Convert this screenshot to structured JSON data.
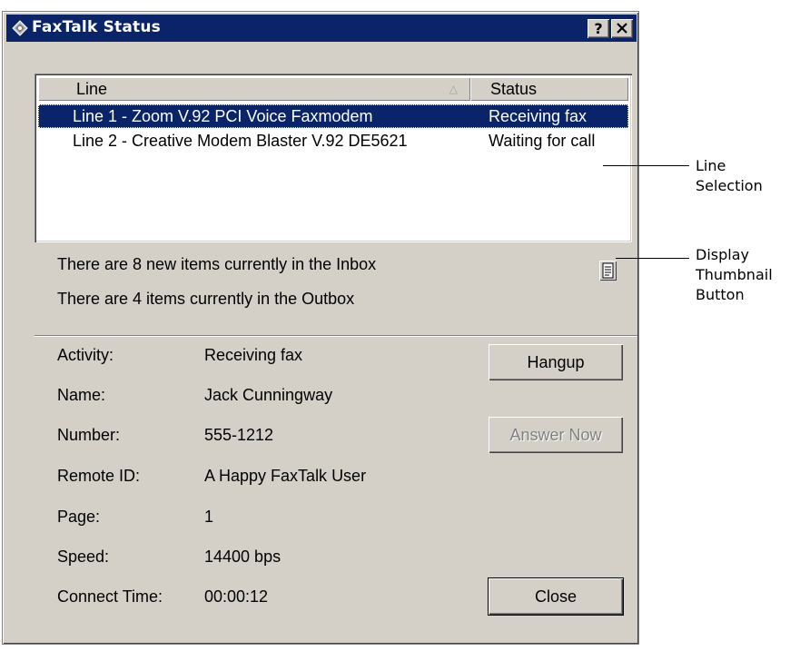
{
  "window": {
    "title": "FaxTalk Status",
    "help_label": "?",
    "close_label": "✕"
  },
  "list": {
    "columns": {
      "line": "Line",
      "status": "Status"
    },
    "sort_indicator": "△",
    "rows": [
      {
        "line": "Line 1 - Zoom V.92 PCI Voice Faxmodem",
        "status": "Receiving fax"
      },
      {
        "line": "Line 2 - Creative Modem Blaster V.92 DE5621",
        "status": "Waiting for call"
      }
    ]
  },
  "summary": {
    "inbox": "There are 8 new items currently in the Inbox",
    "outbox": "There are 4 items currently in the Outbox"
  },
  "details": {
    "activity_label": "Activity:",
    "activity": "Receiving fax",
    "name_label": "Name:",
    "name": "Jack Cunningway",
    "number_label": "Number:",
    "number": "555-1212",
    "remote_label": "Remote ID:",
    "remote": "A Happy FaxTalk User",
    "page_label": "Page:",
    "page": "1",
    "speed_label": "Speed:",
    "speed": "14400 bps",
    "connect_label": "Connect Time:",
    "connect": "00:00:12"
  },
  "buttons": {
    "hangup": "Hangup",
    "answer_now": "Answer Now",
    "close": "Close"
  },
  "callouts": {
    "line_selection": "Line\nSelection",
    "display_thumbnail": "Display\nThumbnail\nButton"
  },
  "colors": {
    "titlebar": "#0a246a",
    "dialog_face": "#d4d0c8",
    "selection": "#0a246a"
  },
  "icons": {
    "app": "faxtalk-app-icon",
    "thumbnail": "document-icon"
  }
}
